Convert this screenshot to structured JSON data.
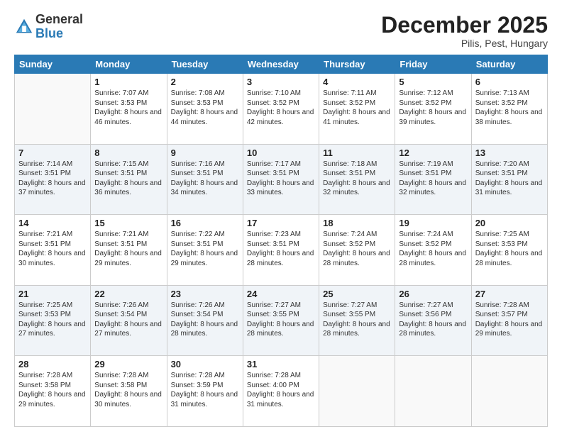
{
  "logo": {
    "general": "General",
    "blue": "Blue"
  },
  "title": "December 2025",
  "location": "Pilis, Pest, Hungary",
  "weekdays": [
    "Sunday",
    "Monday",
    "Tuesday",
    "Wednesday",
    "Thursday",
    "Friday",
    "Saturday"
  ],
  "weeks": [
    [
      {
        "day": "",
        "sunrise": "",
        "sunset": "",
        "daylight": ""
      },
      {
        "day": "1",
        "sunrise": "Sunrise: 7:07 AM",
        "sunset": "Sunset: 3:53 PM",
        "daylight": "Daylight: 8 hours and 46 minutes."
      },
      {
        "day": "2",
        "sunrise": "Sunrise: 7:08 AM",
        "sunset": "Sunset: 3:53 PM",
        "daylight": "Daylight: 8 hours and 44 minutes."
      },
      {
        "day": "3",
        "sunrise": "Sunrise: 7:10 AM",
        "sunset": "Sunset: 3:52 PM",
        "daylight": "Daylight: 8 hours and 42 minutes."
      },
      {
        "day": "4",
        "sunrise": "Sunrise: 7:11 AM",
        "sunset": "Sunset: 3:52 PM",
        "daylight": "Daylight: 8 hours and 41 minutes."
      },
      {
        "day": "5",
        "sunrise": "Sunrise: 7:12 AM",
        "sunset": "Sunset: 3:52 PM",
        "daylight": "Daylight: 8 hours and 39 minutes."
      },
      {
        "day": "6",
        "sunrise": "Sunrise: 7:13 AM",
        "sunset": "Sunset: 3:52 PM",
        "daylight": "Daylight: 8 hours and 38 minutes."
      }
    ],
    [
      {
        "day": "7",
        "sunrise": "Sunrise: 7:14 AM",
        "sunset": "Sunset: 3:51 PM",
        "daylight": "Daylight: 8 hours and 37 minutes."
      },
      {
        "day": "8",
        "sunrise": "Sunrise: 7:15 AM",
        "sunset": "Sunset: 3:51 PM",
        "daylight": "Daylight: 8 hours and 36 minutes."
      },
      {
        "day": "9",
        "sunrise": "Sunrise: 7:16 AM",
        "sunset": "Sunset: 3:51 PM",
        "daylight": "Daylight: 8 hours and 34 minutes."
      },
      {
        "day": "10",
        "sunrise": "Sunrise: 7:17 AM",
        "sunset": "Sunset: 3:51 PM",
        "daylight": "Daylight: 8 hours and 33 minutes."
      },
      {
        "day": "11",
        "sunrise": "Sunrise: 7:18 AM",
        "sunset": "Sunset: 3:51 PM",
        "daylight": "Daylight: 8 hours and 32 minutes."
      },
      {
        "day": "12",
        "sunrise": "Sunrise: 7:19 AM",
        "sunset": "Sunset: 3:51 PM",
        "daylight": "Daylight: 8 hours and 32 minutes."
      },
      {
        "day": "13",
        "sunrise": "Sunrise: 7:20 AM",
        "sunset": "Sunset: 3:51 PM",
        "daylight": "Daylight: 8 hours and 31 minutes."
      }
    ],
    [
      {
        "day": "14",
        "sunrise": "Sunrise: 7:21 AM",
        "sunset": "Sunset: 3:51 PM",
        "daylight": "Daylight: 8 hours and 30 minutes."
      },
      {
        "day": "15",
        "sunrise": "Sunrise: 7:21 AM",
        "sunset": "Sunset: 3:51 PM",
        "daylight": "Daylight: 8 hours and 29 minutes."
      },
      {
        "day": "16",
        "sunrise": "Sunrise: 7:22 AM",
        "sunset": "Sunset: 3:51 PM",
        "daylight": "Daylight: 8 hours and 29 minutes."
      },
      {
        "day": "17",
        "sunrise": "Sunrise: 7:23 AM",
        "sunset": "Sunset: 3:51 PM",
        "daylight": "Daylight: 8 hours and 28 minutes."
      },
      {
        "day": "18",
        "sunrise": "Sunrise: 7:24 AM",
        "sunset": "Sunset: 3:52 PM",
        "daylight": "Daylight: 8 hours and 28 minutes."
      },
      {
        "day": "19",
        "sunrise": "Sunrise: 7:24 AM",
        "sunset": "Sunset: 3:52 PM",
        "daylight": "Daylight: 8 hours and 28 minutes."
      },
      {
        "day": "20",
        "sunrise": "Sunrise: 7:25 AM",
        "sunset": "Sunset: 3:53 PM",
        "daylight": "Daylight: 8 hours and 28 minutes."
      }
    ],
    [
      {
        "day": "21",
        "sunrise": "Sunrise: 7:25 AM",
        "sunset": "Sunset: 3:53 PM",
        "daylight": "Daylight: 8 hours and 27 minutes."
      },
      {
        "day": "22",
        "sunrise": "Sunrise: 7:26 AM",
        "sunset": "Sunset: 3:54 PM",
        "daylight": "Daylight: 8 hours and 27 minutes."
      },
      {
        "day": "23",
        "sunrise": "Sunrise: 7:26 AM",
        "sunset": "Sunset: 3:54 PM",
        "daylight": "Daylight: 8 hours and 28 minutes."
      },
      {
        "day": "24",
        "sunrise": "Sunrise: 7:27 AM",
        "sunset": "Sunset: 3:55 PM",
        "daylight": "Daylight: 8 hours and 28 minutes."
      },
      {
        "day": "25",
        "sunrise": "Sunrise: 7:27 AM",
        "sunset": "Sunset: 3:55 PM",
        "daylight": "Daylight: 8 hours and 28 minutes."
      },
      {
        "day": "26",
        "sunrise": "Sunrise: 7:27 AM",
        "sunset": "Sunset: 3:56 PM",
        "daylight": "Daylight: 8 hours and 28 minutes."
      },
      {
        "day": "27",
        "sunrise": "Sunrise: 7:28 AM",
        "sunset": "Sunset: 3:57 PM",
        "daylight": "Daylight: 8 hours and 29 minutes."
      }
    ],
    [
      {
        "day": "28",
        "sunrise": "Sunrise: 7:28 AM",
        "sunset": "Sunset: 3:58 PM",
        "daylight": "Daylight: 8 hours and 29 minutes."
      },
      {
        "day": "29",
        "sunrise": "Sunrise: 7:28 AM",
        "sunset": "Sunset: 3:58 PM",
        "daylight": "Daylight: 8 hours and 30 minutes."
      },
      {
        "day": "30",
        "sunrise": "Sunrise: 7:28 AM",
        "sunset": "Sunset: 3:59 PM",
        "daylight": "Daylight: 8 hours and 31 minutes."
      },
      {
        "day": "31",
        "sunrise": "Sunrise: 7:28 AM",
        "sunset": "Sunset: 4:00 PM",
        "daylight": "Daylight: 8 hours and 31 minutes."
      },
      {
        "day": "",
        "sunrise": "",
        "sunset": "",
        "daylight": ""
      },
      {
        "day": "",
        "sunrise": "",
        "sunset": "",
        "daylight": ""
      },
      {
        "day": "",
        "sunrise": "",
        "sunset": "",
        "daylight": ""
      }
    ]
  ]
}
